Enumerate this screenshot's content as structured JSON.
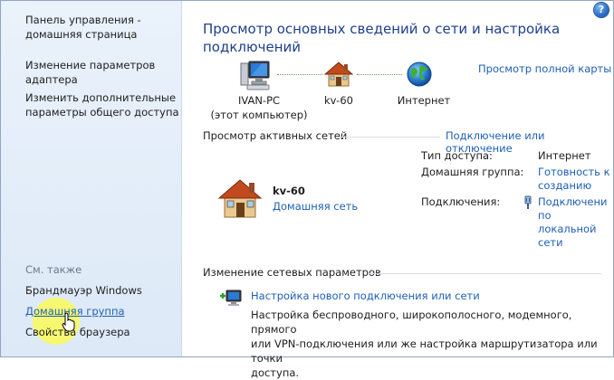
{
  "sidebar": {
    "links": [
      {
        "label_1": "Панель управления -",
        "label_2": "домашняя страница"
      },
      {
        "label_1": "Изменение параметров",
        "label_2": "адаптера"
      },
      {
        "label_1": "Изменить дополнительные",
        "label_2": "параметры общего доступа"
      }
    ],
    "see_also_heading": "См. также",
    "see_also": [
      "Брандмауэр Windows",
      "Домашняя группа",
      "Свойства браузера"
    ]
  },
  "header": {
    "title_line1": "Просмотр основных сведений о сети и настройка",
    "title_line2": "подключений",
    "help_symbol": "?"
  },
  "network_map": {
    "full_map_link": "Просмотр полной карты",
    "computer_name": "IVAN-PC",
    "computer_sub": "(этот компьютер)",
    "network_name": "kv-60",
    "internet_label": "Интернет"
  },
  "active_networks": {
    "heading": "Просмотр активных сетей",
    "connect_link": "Подключение или отключение",
    "network_name": "kv-60",
    "network_type_link": "Домашняя сеть",
    "access_type_label": "Тип доступа:",
    "access_type_value": "Интернет",
    "homegroup_label": "Домашняя группа:",
    "homegroup_value_1": "Готовность к",
    "homegroup_value_2": "созданию",
    "connections_label": "Подключения:",
    "connections_value_1": "Подключени",
    "connections_value_2": "по",
    "connections_value_3": "локальной",
    "connections_value_4": "сети"
  },
  "change_settings": {
    "heading": "Изменение сетевых параметров",
    "new_connection_link": "Настройка нового подключения или сети",
    "description_1": "Настройка беспроводного, широкополосного, модемного, прямого",
    "description_2": "или VPN-подключения или же настройка маршрутизатора или точки",
    "description_3": "доступа."
  },
  "colors": {
    "link": "#1e5fb4",
    "title": "#1e3f8a",
    "sidebar_bg": "#e3edf9",
    "highlight": "#fafa5a"
  }
}
